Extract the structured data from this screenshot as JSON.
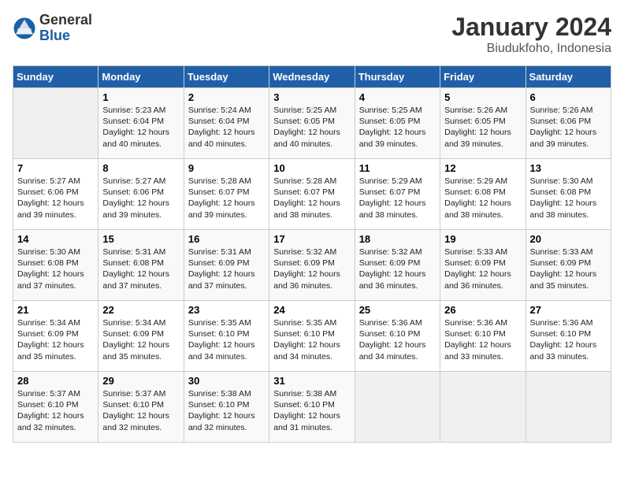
{
  "header": {
    "logo_general": "General",
    "logo_blue": "Blue",
    "month_title": "January 2024",
    "location": "Biudukfoho, Indonesia"
  },
  "days_of_week": [
    "Sunday",
    "Monday",
    "Tuesday",
    "Wednesday",
    "Thursday",
    "Friday",
    "Saturday"
  ],
  "weeks": [
    [
      {
        "day": "",
        "info": ""
      },
      {
        "day": "1",
        "info": "Sunrise: 5:23 AM\nSunset: 6:04 PM\nDaylight: 12 hours\nand 40 minutes."
      },
      {
        "day": "2",
        "info": "Sunrise: 5:24 AM\nSunset: 6:04 PM\nDaylight: 12 hours\nand 40 minutes."
      },
      {
        "day": "3",
        "info": "Sunrise: 5:25 AM\nSunset: 6:05 PM\nDaylight: 12 hours\nand 40 minutes."
      },
      {
        "day": "4",
        "info": "Sunrise: 5:25 AM\nSunset: 6:05 PM\nDaylight: 12 hours\nand 39 minutes."
      },
      {
        "day": "5",
        "info": "Sunrise: 5:26 AM\nSunset: 6:05 PM\nDaylight: 12 hours\nand 39 minutes."
      },
      {
        "day": "6",
        "info": "Sunrise: 5:26 AM\nSunset: 6:06 PM\nDaylight: 12 hours\nand 39 minutes."
      }
    ],
    [
      {
        "day": "7",
        "info": "Sunrise: 5:27 AM\nSunset: 6:06 PM\nDaylight: 12 hours\nand 39 minutes."
      },
      {
        "day": "8",
        "info": "Sunrise: 5:27 AM\nSunset: 6:06 PM\nDaylight: 12 hours\nand 39 minutes."
      },
      {
        "day": "9",
        "info": "Sunrise: 5:28 AM\nSunset: 6:07 PM\nDaylight: 12 hours\nand 39 minutes."
      },
      {
        "day": "10",
        "info": "Sunrise: 5:28 AM\nSunset: 6:07 PM\nDaylight: 12 hours\nand 38 minutes."
      },
      {
        "day": "11",
        "info": "Sunrise: 5:29 AM\nSunset: 6:07 PM\nDaylight: 12 hours\nand 38 minutes."
      },
      {
        "day": "12",
        "info": "Sunrise: 5:29 AM\nSunset: 6:08 PM\nDaylight: 12 hours\nand 38 minutes."
      },
      {
        "day": "13",
        "info": "Sunrise: 5:30 AM\nSunset: 6:08 PM\nDaylight: 12 hours\nand 38 minutes."
      }
    ],
    [
      {
        "day": "14",
        "info": "Sunrise: 5:30 AM\nSunset: 6:08 PM\nDaylight: 12 hours\nand 37 minutes."
      },
      {
        "day": "15",
        "info": "Sunrise: 5:31 AM\nSunset: 6:08 PM\nDaylight: 12 hours\nand 37 minutes."
      },
      {
        "day": "16",
        "info": "Sunrise: 5:31 AM\nSunset: 6:09 PM\nDaylight: 12 hours\nand 37 minutes."
      },
      {
        "day": "17",
        "info": "Sunrise: 5:32 AM\nSunset: 6:09 PM\nDaylight: 12 hours\nand 36 minutes."
      },
      {
        "day": "18",
        "info": "Sunrise: 5:32 AM\nSunset: 6:09 PM\nDaylight: 12 hours\nand 36 minutes."
      },
      {
        "day": "19",
        "info": "Sunrise: 5:33 AM\nSunset: 6:09 PM\nDaylight: 12 hours\nand 36 minutes."
      },
      {
        "day": "20",
        "info": "Sunrise: 5:33 AM\nSunset: 6:09 PM\nDaylight: 12 hours\nand 35 minutes."
      }
    ],
    [
      {
        "day": "21",
        "info": "Sunrise: 5:34 AM\nSunset: 6:09 PM\nDaylight: 12 hours\nand 35 minutes."
      },
      {
        "day": "22",
        "info": "Sunrise: 5:34 AM\nSunset: 6:09 PM\nDaylight: 12 hours\nand 35 minutes."
      },
      {
        "day": "23",
        "info": "Sunrise: 5:35 AM\nSunset: 6:10 PM\nDaylight: 12 hours\nand 34 minutes."
      },
      {
        "day": "24",
        "info": "Sunrise: 5:35 AM\nSunset: 6:10 PM\nDaylight: 12 hours\nand 34 minutes."
      },
      {
        "day": "25",
        "info": "Sunrise: 5:36 AM\nSunset: 6:10 PM\nDaylight: 12 hours\nand 34 minutes."
      },
      {
        "day": "26",
        "info": "Sunrise: 5:36 AM\nSunset: 6:10 PM\nDaylight: 12 hours\nand 33 minutes."
      },
      {
        "day": "27",
        "info": "Sunrise: 5:36 AM\nSunset: 6:10 PM\nDaylight: 12 hours\nand 33 minutes."
      }
    ],
    [
      {
        "day": "28",
        "info": "Sunrise: 5:37 AM\nSunset: 6:10 PM\nDaylight: 12 hours\nand 32 minutes."
      },
      {
        "day": "29",
        "info": "Sunrise: 5:37 AM\nSunset: 6:10 PM\nDaylight: 12 hours\nand 32 minutes."
      },
      {
        "day": "30",
        "info": "Sunrise: 5:38 AM\nSunset: 6:10 PM\nDaylight: 12 hours\nand 32 minutes."
      },
      {
        "day": "31",
        "info": "Sunrise: 5:38 AM\nSunset: 6:10 PM\nDaylight: 12 hours\nand 31 minutes."
      },
      {
        "day": "",
        "info": ""
      },
      {
        "day": "",
        "info": ""
      },
      {
        "day": "",
        "info": ""
      }
    ]
  ]
}
